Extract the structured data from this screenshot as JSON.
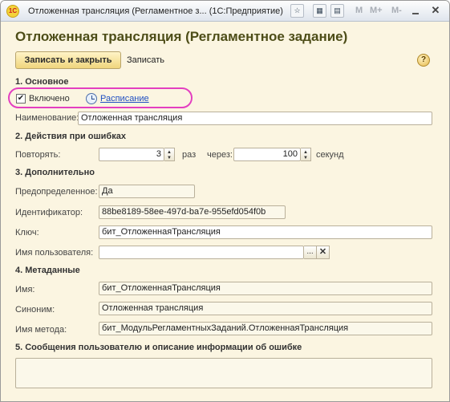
{
  "window": {
    "title": "Отложенная трансляция (Регламентное з...   (1С:Предприятие)",
    "app_icon": "1C",
    "toolbar_m": [
      "M",
      "M+",
      "M-"
    ]
  },
  "form": {
    "title": "Отложенная трансляция (Регламентное задание)",
    "save_close_label": "Записать и закрыть",
    "save_label": "Записать",
    "help_label": "?"
  },
  "sections": {
    "basic": "1. Основное",
    "errors": "2. Действия при ошибках",
    "extra": "3. Дополнительно",
    "metadata": "4. Метаданные",
    "messages": "5. Сообщения пользователю и описание информации об ошибке"
  },
  "basic": {
    "enabled_label": "Включено",
    "enabled_checked": true,
    "schedule_link": "Расписание",
    "name_label": "Наименование:",
    "name_value": "Отложенная трансляция"
  },
  "errors": {
    "repeat_label": "Повторять:",
    "repeat_value": "3",
    "times_label": "раз",
    "interval_label": "через:",
    "interval_value": "100",
    "seconds_label": "секунд"
  },
  "extra": {
    "predefined_label": "Предопределенное:",
    "predefined_value": "Да",
    "id_label": "Идентификатор:",
    "id_value": "88be8189-58ee-497d-ba7e-955efd054f0b",
    "key_label": "Ключ:",
    "key_value": "бит_ОтложеннаяТрансляция",
    "user_label": "Имя пользователя:",
    "user_value": ""
  },
  "metadata": {
    "name_label": "Имя:",
    "name_value": "бит_ОтложеннаяТрансляция",
    "synonym_label": "Синоним:",
    "synonym_value": "Отложенная трансляция",
    "method_label": "Имя метода:",
    "method_value": "бит_МодульРегламентныхЗаданий.ОтложеннаяТрансляция"
  },
  "colors": {
    "background": "#fbf5e1",
    "title": "#4d4d18",
    "highlight": "#e33fc0",
    "link": "#1f4fc2"
  }
}
